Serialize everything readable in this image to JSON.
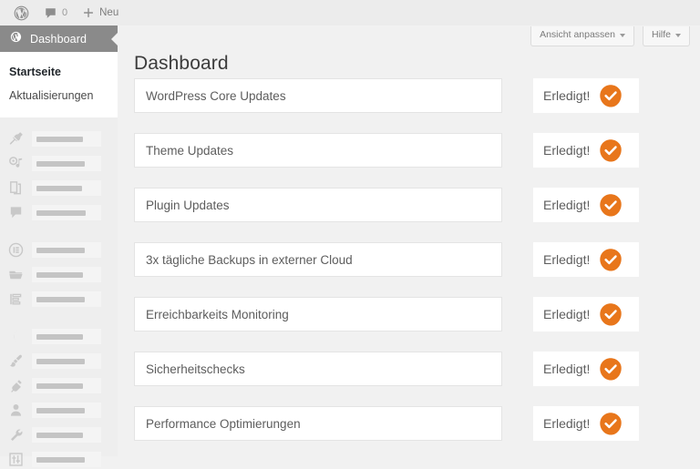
{
  "adminbar": {
    "logo_icon": "wordpress-logo-icon",
    "comments_icon": "comment-bubble-icon",
    "comments_count": "0",
    "new_icon": "plus-icon",
    "new_label": "Neu"
  },
  "sidebar": {
    "active_item": {
      "icon": "dashboard-icon",
      "label": "Dashboard"
    },
    "submenu": [
      {
        "label": "Startseite",
        "current": true
      },
      {
        "label": "Aktualisierungen",
        "current": false
      }
    ],
    "placeholder_groups": [
      {
        "items": [
          {
            "icon": "pin-posts-icon"
          },
          {
            "icon": "media-icon"
          },
          {
            "icon": "pages-icon"
          },
          {
            "icon": "comments-icon"
          }
        ]
      },
      {
        "items": [
          {
            "icon": "elementor-icon"
          },
          {
            "icon": "templates-folder-icon"
          },
          {
            "icon": "forms-list-icon"
          }
        ]
      },
      {
        "items": [
          {
            "icon": "moon-crescent-icon"
          },
          {
            "icon": "appearance-brush-icon"
          },
          {
            "icon": "plugins-plug-icon"
          },
          {
            "icon": "users-icon"
          },
          {
            "icon": "tools-wrench-icon"
          },
          {
            "icon": "settings-sliders-icon"
          }
        ]
      }
    ]
  },
  "screen_meta": {
    "screen_options_label": "Ansicht anpassen",
    "help_label": "Hilfe",
    "caret_icon": "chevron-down-icon"
  },
  "main": {
    "page_title": "Dashboard",
    "status_icon": "orange-check-badge-icon",
    "rows": [
      {
        "title": "WordPress Core Updates",
        "status": "Erledigt!"
      },
      {
        "title": "Theme Updates",
        "status": "Erledigt!"
      },
      {
        "title": "Plugin Updates",
        "status": "Erledigt!"
      },
      {
        "title": "3x tägliche Backups in externer Cloud",
        "status": "Erledigt!"
      },
      {
        "title": "Erreichbarkeits Monitoring",
        "status": "Erledigt!"
      },
      {
        "title": "Sicherheitschecks",
        "status": "Erledigt!"
      },
      {
        "title": "Performance Optimierungen",
        "status": "Erledigt!"
      }
    ]
  },
  "colors": {
    "accent_orange": "#E8761B",
    "adminbar_bg": "#ECECEC",
    "sidebar_bg": "#EEEEEE",
    "active_menu_bg": "#8A8A8A",
    "content_bg": "#F1F1F1",
    "card_bg": "#FFFFFF",
    "text": "#5D5D5D"
  }
}
